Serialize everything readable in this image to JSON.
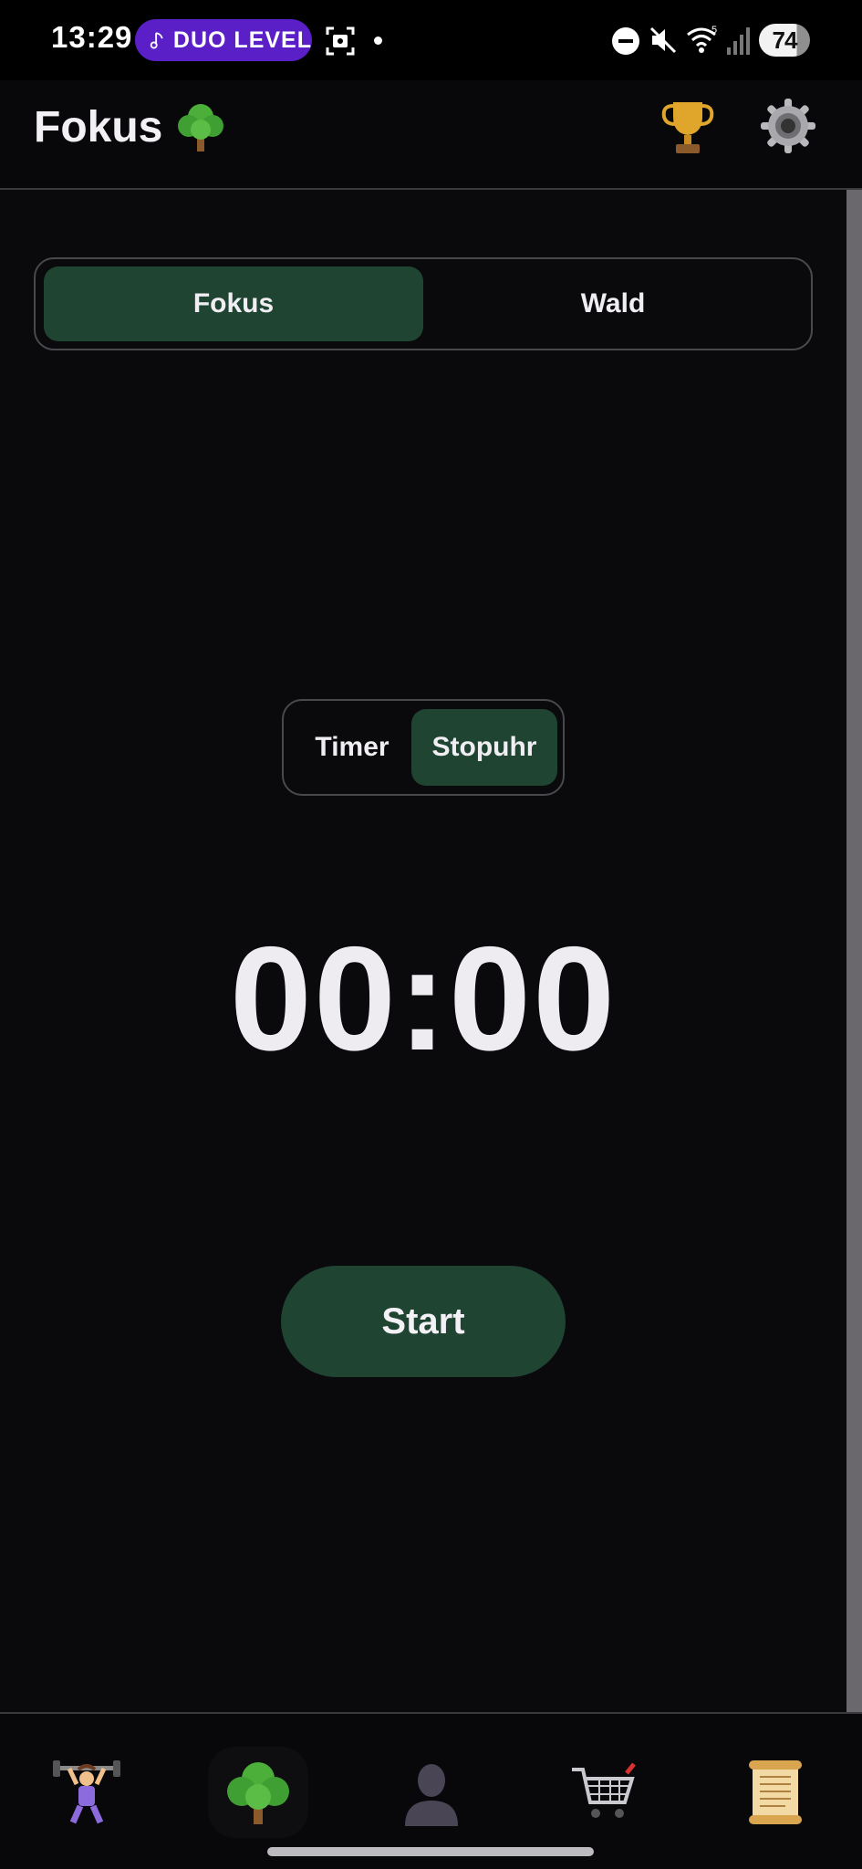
{
  "status_bar": {
    "time": "13:29",
    "media_pill_label": "DUO LEVEL",
    "battery_level": "74",
    "icons": [
      "music-note-icon",
      "screenshot-icon",
      "do-not-disturb-icon",
      "mute-icon",
      "wifi-icon",
      "signal-icon",
      "battery-icon"
    ]
  },
  "app_bar": {
    "title": "Fokus",
    "title_icon": "tree-icon",
    "actions": [
      "trophy-icon",
      "gear-icon"
    ]
  },
  "mode_switch": {
    "options": [
      "Fokus",
      "Wald"
    ],
    "selected": "Fokus"
  },
  "timer_mode_switch": {
    "options": [
      "Timer",
      "Stopuhr"
    ],
    "selected": "Stopuhr"
  },
  "clock": {
    "display": "00:00"
  },
  "start_button": {
    "label": "Start"
  },
  "bottom_nav": {
    "items": [
      "weightlifter-icon",
      "tree-icon",
      "person-icon",
      "cart-icon",
      "scroll-icon"
    ],
    "selected": "tree-icon"
  },
  "colors": {
    "accent": "#1f4432",
    "background": "#0a090c",
    "pill": "#5a1fc6"
  }
}
